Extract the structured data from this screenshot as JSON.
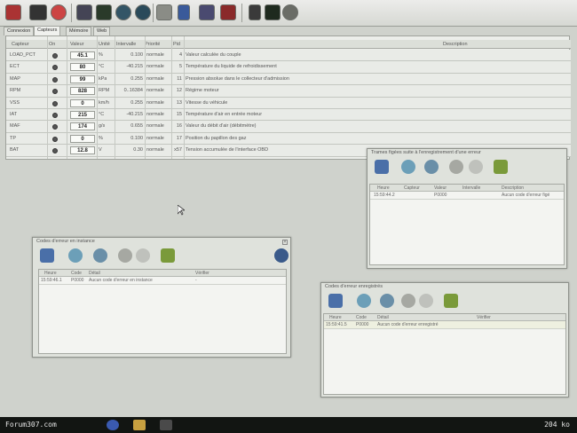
{
  "tabs": [
    "Connexion",
    "Capteurs",
    "Mémoire",
    "Web"
  ],
  "active_tab": "Capteurs",
  "table": {
    "headers": [
      "Capteur",
      "On",
      "Valeur",
      "Unité",
      "Intervalle",
      "Priorité",
      "Pid",
      "Description"
    ],
    "rows": [
      {
        "sensor": "LOAD_PCT",
        "value": "45.1",
        "unit": "%",
        "interval": "0.100",
        "priority": "normale",
        "pid": "4",
        "description": "Valeur calculée du couple"
      },
      {
        "sensor": "ECT",
        "value": "80",
        "unit": "°C",
        "interval": "-40.215",
        "priority": "normale",
        "pid": "5",
        "description": "Température du liquide de refroidissement"
      },
      {
        "sensor": "MAP",
        "value": "99",
        "unit": "kPa",
        "interval": "0.255",
        "priority": "normale",
        "pid": "11",
        "description": "Pression absolue dans le collecteur d'admission"
      },
      {
        "sensor": "RPM",
        "value": "828",
        "unit": "RPM",
        "interval": "0..16384",
        "priority": "normale",
        "pid": "12",
        "description": "Régime moteur"
      },
      {
        "sensor": "VSS",
        "value": "0",
        "unit": "km/h",
        "interval": "0.255",
        "priority": "normale",
        "pid": "13",
        "description": "Vitesse du véhicule"
      },
      {
        "sensor": "IAT",
        "value": "215",
        "unit": "°C",
        "interval": "-40.215",
        "priority": "normale",
        "pid": "15",
        "description": "Température d'air en entrée moteur"
      },
      {
        "sensor": "MAF",
        "value": "174",
        "unit": "g/s",
        "interval": "0.655",
        "priority": "normale",
        "pid": "16",
        "description": "Valeur du débit d'air (débitmètre)"
      },
      {
        "sensor": "TP",
        "value": "0",
        "unit": "%",
        "interval": "0.100",
        "priority": "normale",
        "pid": "17",
        "description": "Position du papillon des gaz"
      },
      {
        "sensor": "BAT",
        "value": "12.8",
        "unit": "V",
        "interval": "0.30",
        "priority": "normale",
        "pid": "x57",
        "description": "Tension accumulée de l'interface OBD"
      }
    ]
  },
  "freeze": {
    "title": "Trames figées suite à l'enregistrement d'une erreur",
    "headers": [
      "Heure",
      "Capteur",
      "Valeur",
      "Intervalle",
      "Description"
    ],
    "row": {
      "time": "15:59:44.2",
      "sensor": "",
      "value": "P0000",
      "interval": "",
      "description": "Aucun code d'erreur figé"
    }
  },
  "pending": {
    "title": "Codes d'erreur en instance",
    "headers": [
      "Heure",
      "Code",
      "Détail",
      "Vérifier"
    ],
    "row": {
      "time": "15:59:46.1",
      "code": "P0000",
      "detail": "Aucun code d'erreur en instance",
      "verify": "-"
    }
  },
  "stored": {
    "title": "Codes d'erreur enregistrés",
    "headers": [
      "Heure",
      "Code",
      "Détail",
      "Vérifier"
    ],
    "row": {
      "time": "15:59:41.5",
      "code": "P0000",
      "detail": "Aucun code d'erreur enregistré",
      "verify": ""
    }
  },
  "watermark": "Forum307.com",
  "size_label": "204 ko"
}
